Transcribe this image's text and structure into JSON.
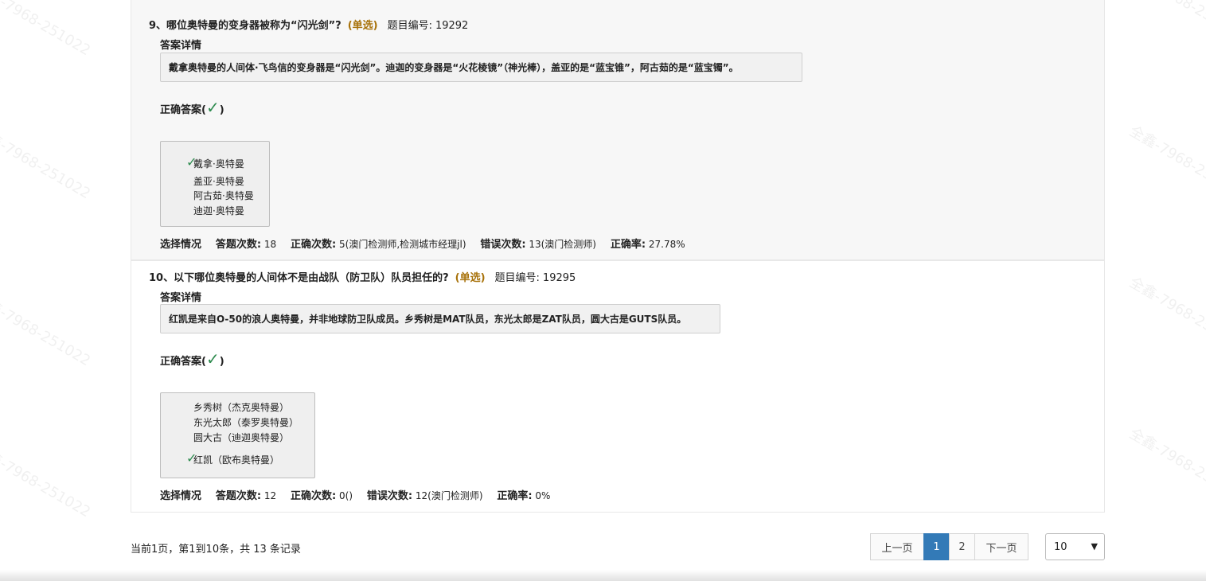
{
  "watermark": "全鑫-7968-251022",
  "questions": [
    {
      "header": "9、哪位奥特曼的变身器被称为“闪光剑”?",
      "type": "(单选)",
      "id_label": "题目编号:",
      "id": "19292",
      "detail_label": "答案详情",
      "detail": "戴拿奥特曼的人间体·飞鸟信的变身器是“闪光剑”。迪迦的变身器是“火花棱镜”（神光棒），盖亚的是“蓝宝锥”，阿古茹的是“蓝宝镯”。",
      "correct_prefix": "正确答案(",
      "correct_suffix": ")",
      "options": [
        "戴拿·奥特曼",
        "盖亚·奥特曼",
        "阿古茹·奥特曼",
        "迪迦·奥特曼"
      ],
      "correct_option_index": 0,
      "stats": {
        "label": "选择情况",
        "answer_count_label": "答题次数:",
        "answer_count": "18",
        "correct_count_label": "正确次数:",
        "correct_count": "5(澳门检测师,检测城市经理jl)",
        "wrong_count_label": "错误次数:",
        "wrong_count": "13(澳门检测师)",
        "accuracy_label": "正确率:",
        "accuracy": "27.78%"
      }
    },
    {
      "header": "10、以下哪位奥特曼的人间体不是由战队（防卫队）队员担任的?",
      "type": "(单选)",
      "id_label": "题目编号:",
      "id": "19295",
      "detail_label": "答案详情",
      "detail": "红凯是来自O-50的浪人奥特曼，并非地球防卫队成员。乡秀树是MAT队员，东光太郎是ZAT队员，圆大古是GUTS队员。",
      "correct_prefix": "正确答案(",
      "correct_suffix": ")",
      "options": [
        "乡秀树（杰克奥特曼）",
        "东光太郎（泰罗奥特曼）",
        "圆大古（迪迦奥特曼）",
        "红凯（欧布奥特曼）"
      ],
      "correct_option_index": 3,
      "stats": {
        "label": "选择情况",
        "answer_count_label": "答题次数:",
        "answer_count": "12",
        "correct_count_label": "正确次数:",
        "correct_count": "0()",
        "wrong_count_label": "错误次数:",
        "wrong_count": "12(澳门检测师)",
        "accuracy_label": "正确率:",
        "accuracy": "0%"
      }
    }
  ],
  "footer": {
    "summary": "当前1页，第1到10条，共 13 条记录",
    "prev": "上一页",
    "pages": [
      "1",
      "2"
    ],
    "active_page": "1",
    "next": "下一页",
    "page_size": "10"
  },
  "icons": {
    "check": "check-icon",
    "dropdown": "chevron-down-icon"
  },
  "colors": {
    "check": "#2e8b4f",
    "type": "#a8720a",
    "active_page": "#337ab7"
  }
}
